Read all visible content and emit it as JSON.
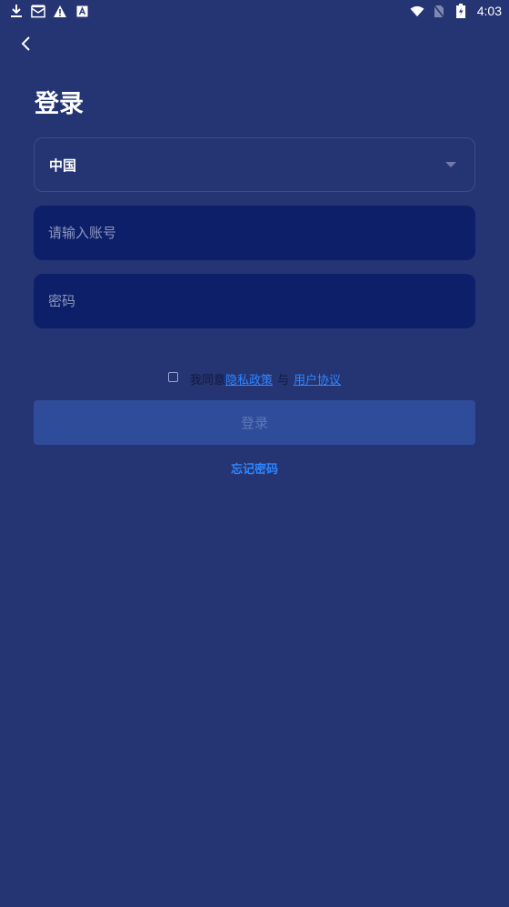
{
  "status_bar": {
    "time": "4:03",
    "left_icons": [
      "download-icon",
      "mail-icon",
      "warning-icon",
      "a-box-icon"
    ],
    "right_icons": [
      "wifi-icon",
      "no-sim-icon",
      "battery-charging-icon"
    ]
  },
  "header": {
    "back_icon": "chevron-left-icon",
    "title": "登录"
  },
  "form": {
    "country": {
      "value": "中国"
    },
    "account": {
      "placeholder": "请输入账号",
      "value": ""
    },
    "password": {
      "placeholder": "密码",
      "value": ""
    }
  },
  "agreement": {
    "prefix": "我同意",
    "privacy_link": "隐私政策",
    "separator": "与",
    "terms_link": "用户协议",
    "checked": false
  },
  "login_button": {
    "label": "登录"
  },
  "forgot_password": {
    "label": "忘记密码"
  },
  "colors": {
    "background": "#253473",
    "input_bg": "#0d1f68",
    "link": "#2f86ff",
    "button_bg": "#2e4c9a"
  }
}
